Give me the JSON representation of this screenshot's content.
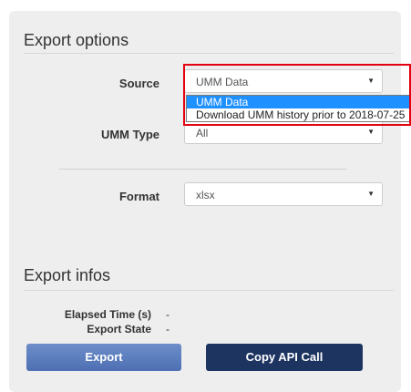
{
  "export_options": {
    "title": "Export options",
    "source": {
      "label": "Source",
      "value": "UMM Data",
      "options": [
        "UMM Data",
        "Download UMM history prior to 2018-07-25"
      ]
    },
    "umm_type": {
      "label": "UMM Type",
      "value": "All"
    },
    "format": {
      "label": "Format",
      "value": "xlsx"
    }
  },
  "export_infos": {
    "title": "Export infos",
    "elapsed_time": {
      "label": "Elapsed Time (s)",
      "value": "-"
    },
    "export_state": {
      "label": "Export State",
      "value": "-"
    }
  },
  "buttons": {
    "export_label": "Export",
    "copy_api_label": "Copy API Call"
  },
  "colors": {
    "panel_bg": "#eeeeee",
    "export_button": "#5b7fc0",
    "copy_api_button": "#1d3461",
    "dropdown_selected": "#1e90ff",
    "highlight_frame": "#e3000f"
  },
  "icons": {
    "select_caret": "▼"
  }
}
